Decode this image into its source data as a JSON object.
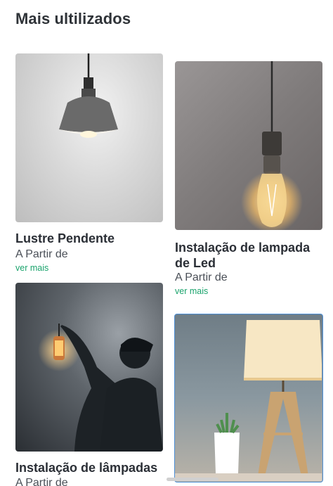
{
  "section": {
    "title": "Mais ultilizados"
  },
  "cards": [
    {
      "name": "Lustre Pendente",
      "price_label": "A Partir de",
      "more_label": "ver mais",
      "image_icon": "pendant-lamp-photo"
    },
    {
      "name": "Instalação de lampada de Led",
      "price_label": "A Partir de",
      "more_label": "ver mais",
      "image_icon": "edison-bulb-photo"
    },
    {
      "name": "Instalação de lâmpadas",
      "price_label": "A Partir de",
      "image_icon": "man-with-lantern-photo"
    },
    {
      "image_icon": "table-lamp-photo"
    }
  ],
  "colors": {
    "accent_link": "#1aa36c",
    "selected_border": "#4d8fd6"
  }
}
